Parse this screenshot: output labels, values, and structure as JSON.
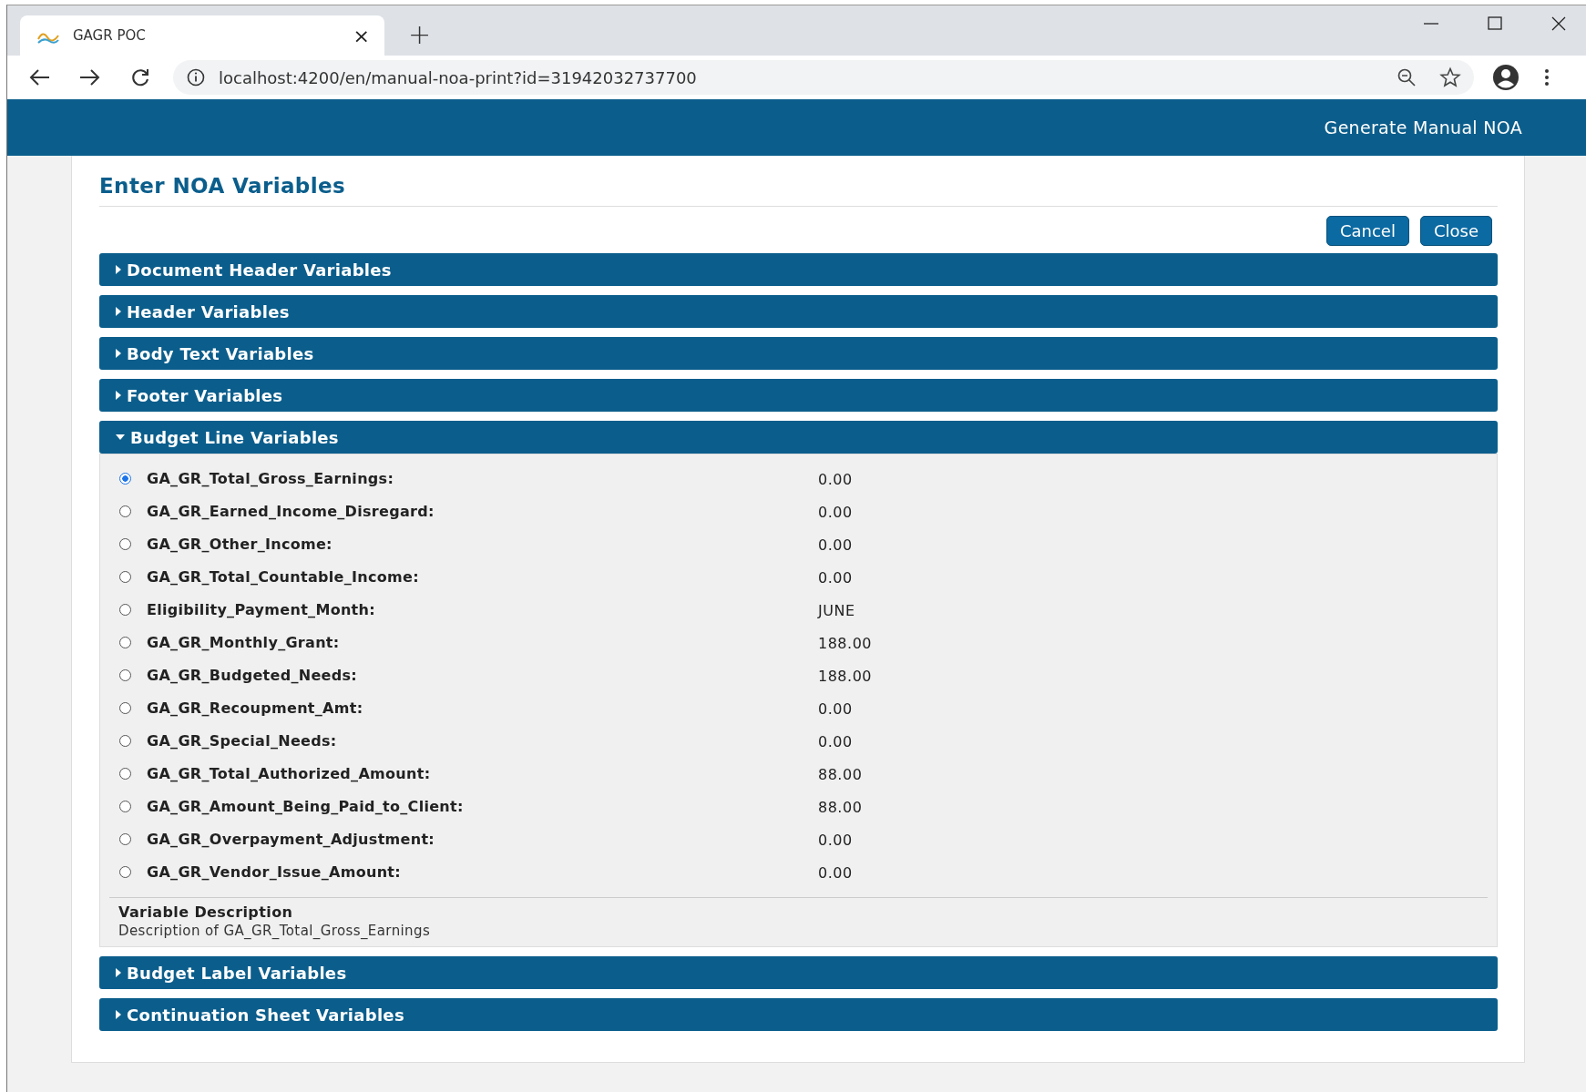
{
  "browser": {
    "tab": {
      "title": "GAGR POC",
      "close": "×"
    },
    "new_tab": "+",
    "url": "localhost:4200/en/manual-noa-print?id=31942032737700"
  },
  "app_bar": {
    "title": "Generate Manual NOA"
  },
  "card": {
    "title": "Enter NOA Variables",
    "buttons": [
      "Cancel",
      "Close"
    ],
    "sections": [
      {
        "title": "Document Header Variables",
        "expanded": false
      },
      {
        "title": "Header Variables",
        "expanded": false
      },
      {
        "title": "Body Text Variables",
        "expanded": false
      },
      {
        "title": "Footer Variables",
        "expanded": false
      },
      {
        "title": "Budget Line Variables",
        "expanded": true,
        "variables": [
          {
            "name": "GA_GR_Total_Gross_Earnings:",
            "value": "0.00",
            "selected": true
          },
          {
            "name": "GA_GR_Earned_Income_Disregard:",
            "value": "0.00",
            "selected": false
          },
          {
            "name": "GA_GR_Other_Income:",
            "value": "0.00",
            "selected": false
          },
          {
            "name": "GA_GR_Total_Countable_Income:",
            "value": "0.00",
            "selected": false
          },
          {
            "name": "Eligibility_Payment_Month:",
            "value": "JUNE",
            "selected": false
          },
          {
            "name": "GA_GR_Monthly_Grant:",
            "value": "188.00",
            "selected": false
          },
          {
            "name": "GA_GR_Budgeted_Needs:",
            "value": "188.00",
            "selected": false
          },
          {
            "name": "GA_GR_Recoupment_Amt:",
            "value": "0.00",
            "selected": false
          },
          {
            "name": "GA_GR_Special_Needs:",
            "value": "0.00",
            "selected": false
          },
          {
            "name": "GA_GR_Total_Authorized_Amount:",
            "value": "88.00",
            "selected": false
          },
          {
            "name": "GA_GR_Amount_Being_Paid_to_Client:",
            "value": "88.00",
            "selected": false
          },
          {
            "name": "GA_GR_Overpayment_Adjustment:",
            "value": "0.00",
            "selected": false
          },
          {
            "name": "GA_GR_Vendor_Issue_Amount:",
            "value": "0.00",
            "selected": false
          }
        ],
        "description": {
          "heading": "Variable Description",
          "text": "Description of GA_GR_Total_Gross_Earnings"
        }
      },
      {
        "title": "Budget Label Variables",
        "expanded": false
      },
      {
        "title": "Continuation Sheet Variables",
        "expanded": false
      }
    ]
  }
}
